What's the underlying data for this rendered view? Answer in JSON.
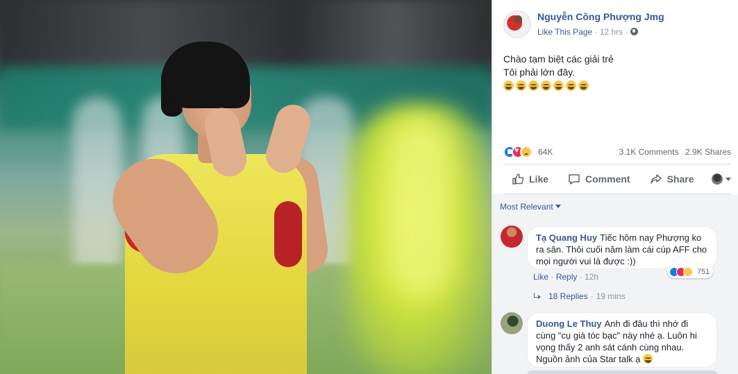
{
  "post": {
    "author": "Nguyễn Công Phượng Jmg",
    "like_page": "Like This Page",
    "separator": "·",
    "time": "12 hrs",
    "text_line1": "Chào tạm biệt các giải trẻ",
    "text_line2": "Tôi phải lớn đây.",
    "emoji_count": 7,
    "emoji_name": "laughing-crying-emoji"
  },
  "stats": {
    "reactions": "64K",
    "comments": "3.1K Comments",
    "shares": "2.9K Shares"
  },
  "actions": {
    "like": "Like",
    "comment": "Comment",
    "share": "Share"
  },
  "comments": {
    "sort_label": "Most Relevant",
    "items": [
      {
        "author": "Tạ Quang Huy",
        "text": "Tiếc hôm nay Phượng ko ra sân. Thôi cuối năm làm cái cúp AFF cho mọi người vui là được :))",
        "reactions": "751",
        "like": "Like",
        "reply": "Reply",
        "dot": "·",
        "time": "12h",
        "replies": "18 Replies",
        "replies_time": "19 mins"
      },
      {
        "author": "Duong Le Thuy",
        "text_line1": "Anh đi đâu thì nhớ đi cùng \"cụ già tóc bạc\" này nhé ạ. Luôn hi vọng thấy 2 anh sát cánh cùng nhau.",
        "text_line2": "Nguồn ảnh của Star talk ạ"
      }
    ]
  },
  "colors": {
    "link_blue": "#365899",
    "meta_gray": "#90949c",
    "action_gray": "#606770",
    "like_blue": "#1877f2",
    "love_red": "#f0284a",
    "emoji_yellow": "#f7c94b"
  }
}
